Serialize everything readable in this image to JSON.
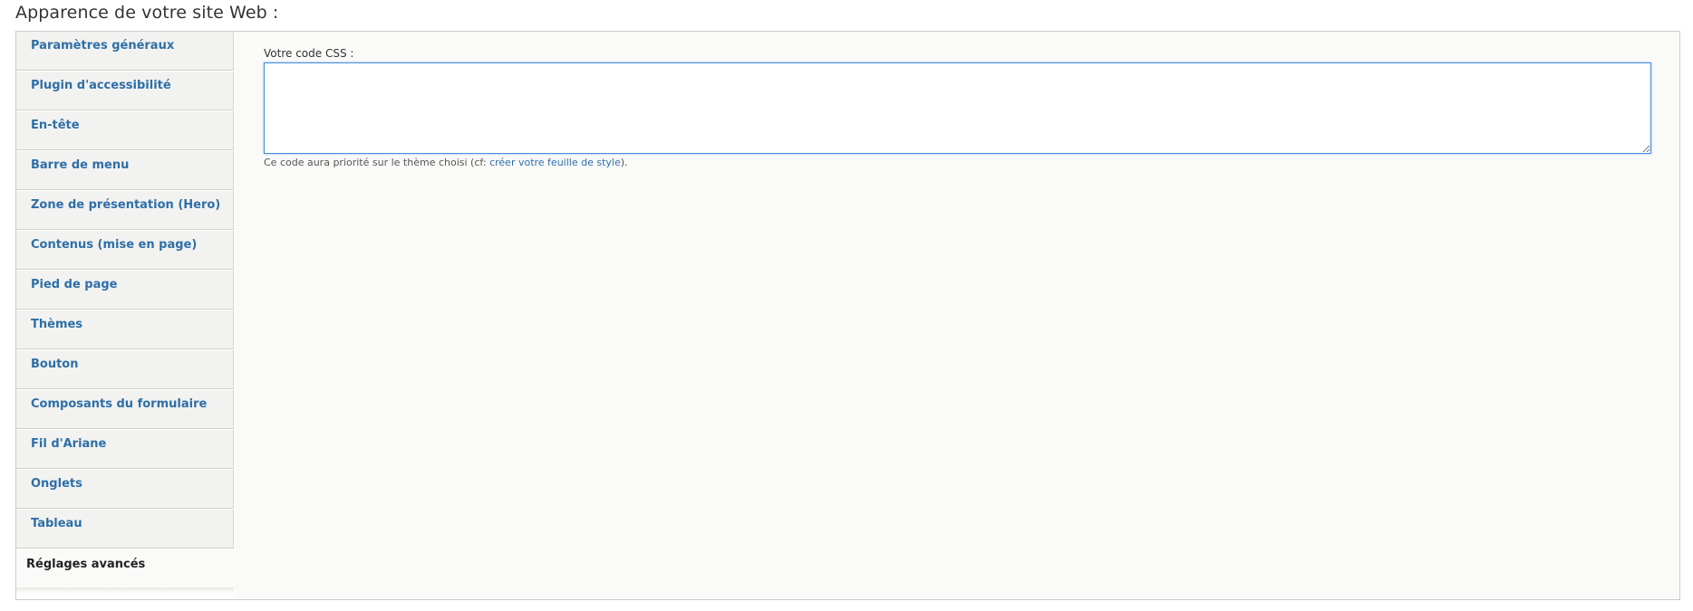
{
  "page": {
    "title": "Apparence de votre site Web :"
  },
  "vertical_tabs": [
    {
      "label": "Paramètres généraux"
    },
    {
      "label": "Plugin d'accessibilité"
    },
    {
      "label": "En-tête"
    },
    {
      "label": "Barre de menu"
    },
    {
      "label": "Zone de présentation (Hero)"
    },
    {
      "label": "Contenus (mise en page)"
    },
    {
      "label": "Pied de page"
    },
    {
      "label": "Thèmes"
    },
    {
      "label": "Bouton"
    },
    {
      "label": "Composants du formulaire"
    },
    {
      "label": "Fil d'Ariane"
    },
    {
      "label": "Onglets"
    },
    {
      "label": "Tableau"
    },
    {
      "label": "Réglages avancés",
      "selected": true
    }
  ],
  "advanced": {
    "css_label": "Votre code CSS :",
    "css_value": "",
    "help_prefix": "Ce code aura priorité sur le thème choisi (cf: ",
    "help_link": "créer votre feuille de style",
    "help_suffix": ")."
  },
  "colors": {
    "link": "#2e6fa7",
    "focus_border": "#4a90d9"
  }
}
